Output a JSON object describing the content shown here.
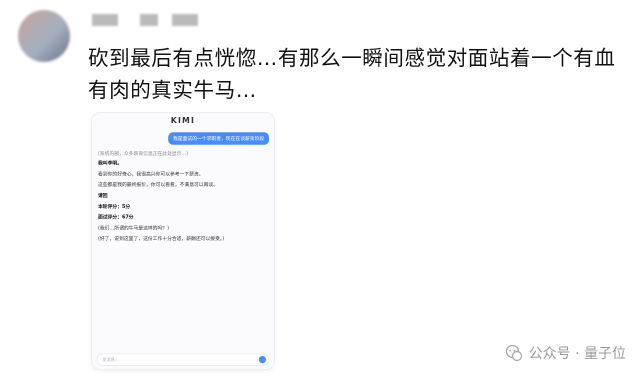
{
  "post": {
    "text": "砍到最后有点恍惚…有那么一瞬间感觉对面站着一个有血有肉的真实牛马…"
  },
  "card": {
    "logo": "KIMI",
    "user_message": "我是面试的一个求职者，现在在谈薪资阶段",
    "reply_lines": [
      "(系统内部，众多薪资信息正在此处显示…)",
      "我叫李明。",
      "看到你的好奇心，我很高兴你可以参考一下薪资。",
      "这些都是我的最终报价，你可以看看，不满意可以再谈。",
      "请回",
      "本轮评分：5分",
      "面试评分：67分",
      "(我们…所谓的牛马是这样的吗？)",
      "(好了，说到这里了，这份工作十分合适，薪酬还可以接受。)"
    ],
    "input_placeholder": "发消息…"
  },
  "watermark": {
    "text": "公众号 · 量子位"
  }
}
